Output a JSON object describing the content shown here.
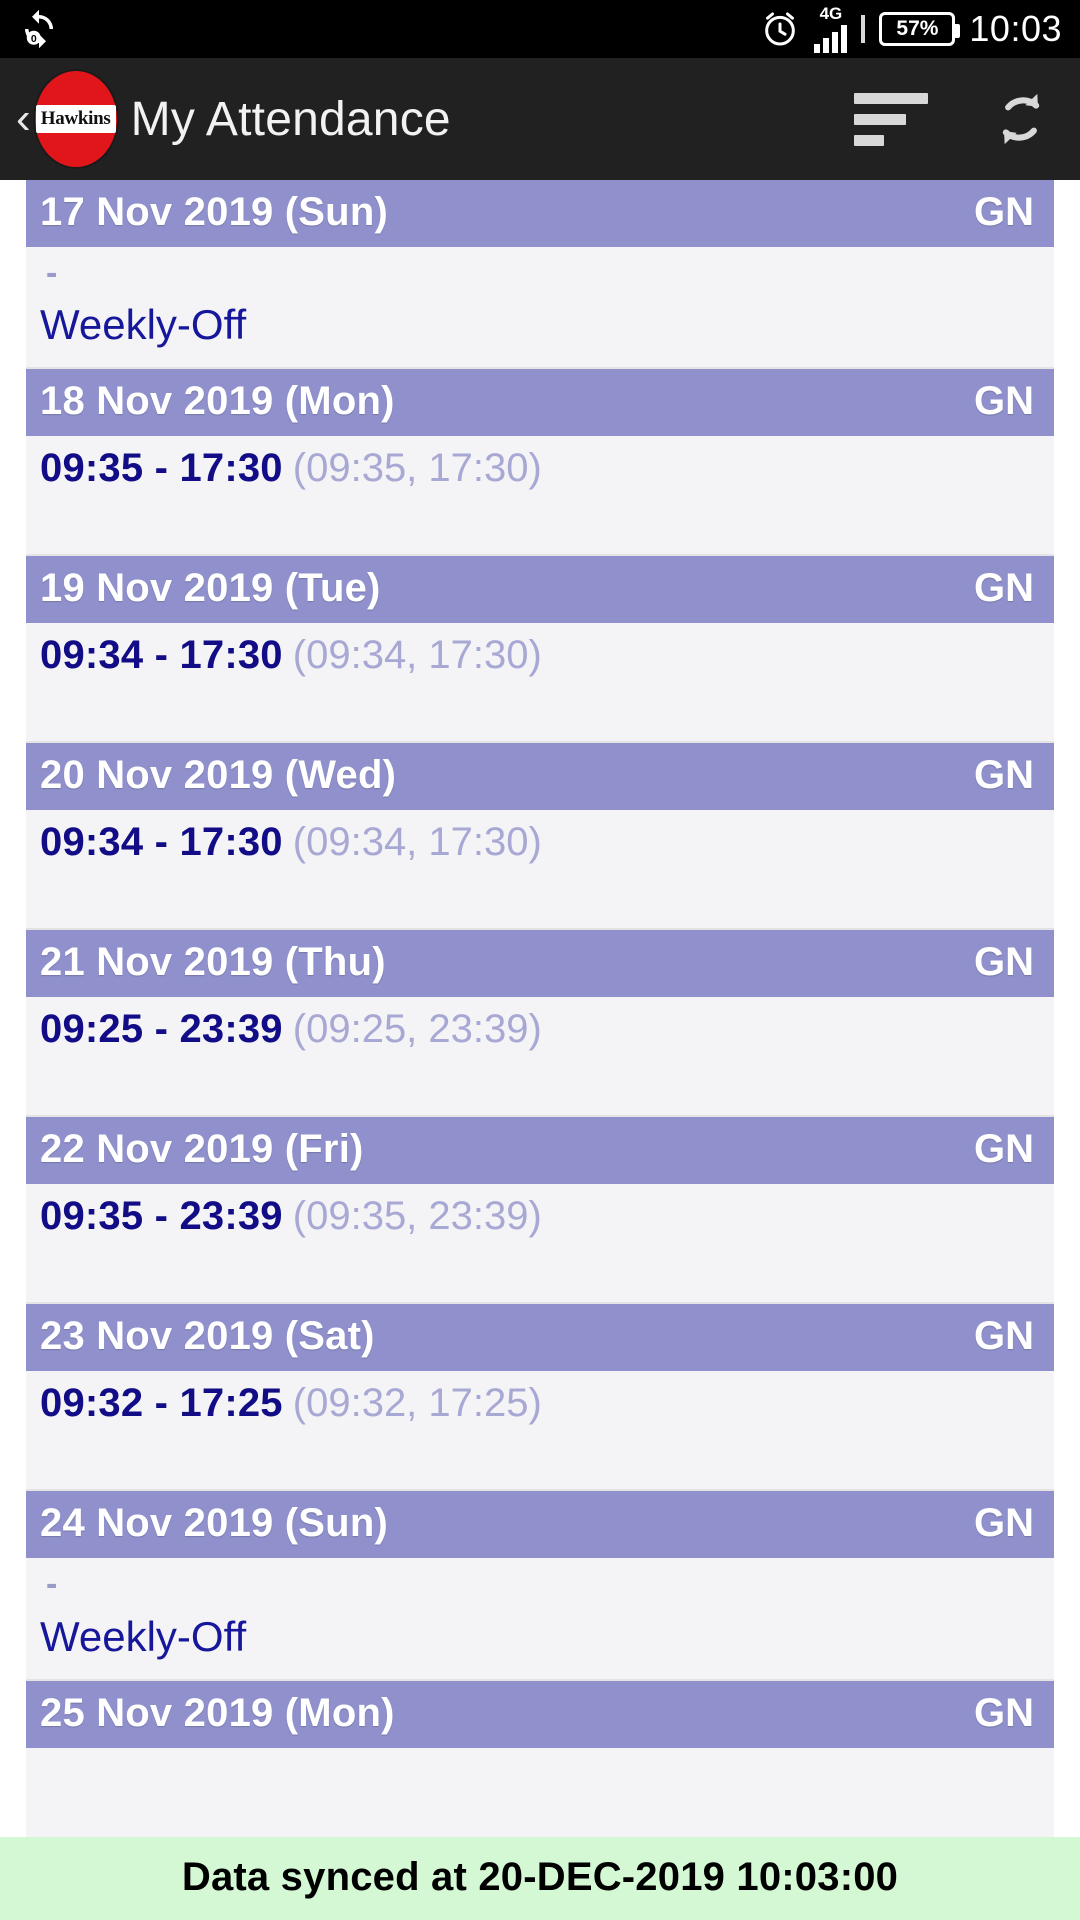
{
  "status_bar": {
    "sync_icon": "sync-rotate-icon",
    "alarm_icon": "alarm-clock-icon",
    "network_label": "4G",
    "signal_icon": "signal-bars-icon",
    "battery_percent": "57%",
    "time": "10:03"
  },
  "app_bar": {
    "back_label": "‹",
    "logo_text": "Hawkins",
    "title": "My Attendance",
    "sort_icon": "sort-filter-icon",
    "refresh_icon": "refresh-icon"
  },
  "records": [
    {
      "date": "17 Nov 2019 (Sun)",
      "shift": "GN",
      "type": "off",
      "dash": "-",
      "status": "Weekly-Off",
      "times": "",
      "raw": ""
    },
    {
      "date": "18 Nov 2019 (Mon)",
      "shift": "GN",
      "type": "present",
      "dash": "",
      "status": "",
      "times": "09:35 - 17:30",
      "raw": "(09:35, 17:30)"
    },
    {
      "date": "19 Nov 2019 (Tue)",
      "shift": "GN",
      "type": "present",
      "dash": "",
      "status": "",
      "times": "09:34 - 17:30",
      "raw": "(09:34, 17:30)"
    },
    {
      "date": "20 Nov 2019 (Wed)",
      "shift": "GN",
      "type": "present",
      "dash": "",
      "status": "",
      "times": "09:34 - 17:30",
      "raw": "(09:34, 17:30)"
    },
    {
      "date": "21 Nov 2019 (Thu)",
      "shift": "GN",
      "type": "present",
      "dash": "",
      "status": "",
      "times": "09:25 - 23:39",
      "raw": "(09:25, 23:39)"
    },
    {
      "date": "22 Nov 2019 (Fri)",
      "shift": "GN",
      "type": "present",
      "dash": "",
      "status": "",
      "times": "09:35 - 23:39",
      "raw": "(09:35, 23:39)"
    },
    {
      "date": "23 Nov 2019 (Sat)",
      "shift": "GN",
      "type": "present",
      "dash": "",
      "status": "",
      "times": "09:32 - 17:25",
      "raw": "(09:32, 17:25)"
    },
    {
      "date": "24 Nov 2019 (Sun)",
      "shift": "GN",
      "type": "off",
      "dash": "-",
      "status": "Weekly-Off",
      "times": "",
      "raw": ""
    },
    {
      "date": "25 Nov 2019 (Mon)",
      "shift": "GN",
      "type": "present",
      "dash": "",
      "status": "",
      "times": "",
      "raw": ""
    }
  ],
  "sync_banner": {
    "text": "Data synced at 20-DEC-2019 10:03:00"
  },
  "colors": {
    "header_purple": "#8f90cc",
    "time_navy": "#120d87",
    "raw_purple": "#a8a8d4",
    "off_navy": "#17179b",
    "banner_green": "#d4f7d4",
    "appbar_dark": "#212121",
    "logo_red": "#e0161b"
  }
}
